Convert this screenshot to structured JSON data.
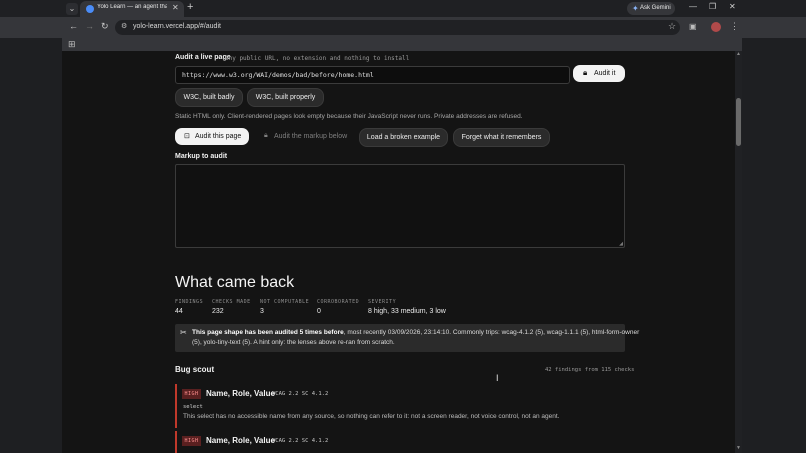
{
  "browser": {
    "tab_title": "Yolo Learn — an agent that lea",
    "tab_close": "✕",
    "new_tab": "+",
    "gemini_label": "Ask Gemini",
    "url": "yolo-learn.vercel.app/#/audit",
    "icons": {
      "back": "arrow-left-icon",
      "forward": "arrow-right-icon",
      "reload": "reload-icon",
      "site_info": "tune-icon",
      "bookmark": "star-icon",
      "extensions": "puzzle-icon",
      "menu": "kebab-menu-icon",
      "apps": "apps-grid-icon"
    }
  },
  "audit": {
    "label": "Audit a live page",
    "hint": "any public URL, no extension and nothing to install",
    "url_value": "https://www.w3.org/WAI/demos/bad/before/home.html",
    "audit_button": "Audit it",
    "preset_bad": "W3C, built badly",
    "preset_good": "W3C, built properly",
    "static_note": "Static HTML only. Client-rendered pages look empty because their JavaScript never runs. Private addresses are refused.",
    "audit_page_button": "Audit this page",
    "audit_markup_button": "Audit the markup below",
    "load_broken_button": "Load a broken example",
    "forget_button": "Forget what it remembers",
    "markup_label": "Markup to audit"
  },
  "results": {
    "heading": "What came back",
    "stats": [
      {
        "label": "FINDINGS",
        "value": "44"
      },
      {
        "label": "CHECKS MADE",
        "value": "232"
      },
      {
        "label": "NOT COMPUTABLE",
        "value": "3"
      },
      {
        "label": "CORROBORATED",
        "value": "0"
      },
      {
        "label": "SEVERITY",
        "value": "8 high, 33 medium, 3 low"
      }
    ],
    "banner_bold": "This page shape has been audited 5 times before",
    "banner_rest": ", most recently 03/09/2026, 23:14:10. Commonly trips: wcag-4.1.2 (5), wcag-1.1.1 (5), html-form-owner",
    "banner_line2": "(5), yolo-tiny-text (5). A hint only: the lenses above re-ran from scratch."
  },
  "bug_scout": {
    "heading": "Bug scout",
    "summary": "42 findings from 115 checks",
    "findings": [
      {
        "severity": "HIGH",
        "title": "Name, Role, Value",
        "wcag": "WCAG 2.2 SC 4.1.2",
        "element": "select",
        "description": "This select has no accessible name from any source, so nothing can refer to it: not a screen reader, not voice control, not an agent."
      },
      {
        "severity": "HIGH",
        "title": "Name, Role, Value",
        "wcag": "WCAG 2.2 SC 4.1.2",
        "element": "",
        "description": ""
      }
    ]
  },
  "colors": {
    "page_bg": "#141414",
    "chrome_bg": "#35363a",
    "severity_high": "#c0392b",
    "primary_button": "#f3f3f3"
  }
}
